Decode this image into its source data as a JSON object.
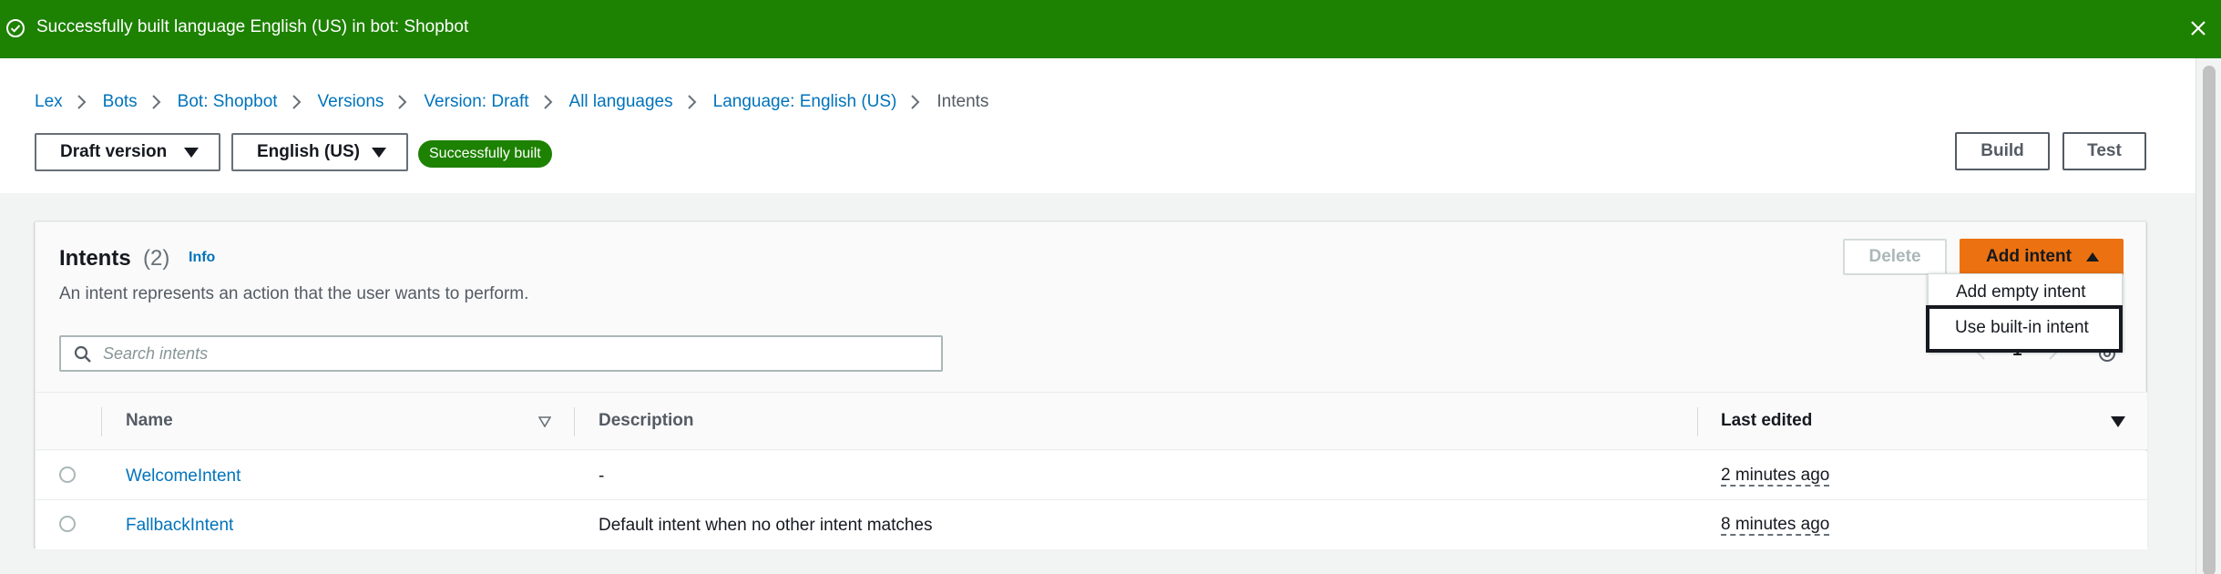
{
  "flash": {
    "message": "Successfully built language English (US) in bot: Shopbot",
    "icon": "check-circle-icon",
    "close_icon": "close-icon",
    "color": "#1d8102"
  },
  "breadcrumb": [
    "Lex",
    "Bots",
    "Bot: Shopbot",
    "Versions",
    "Version: Draft",
    "All languages",
    "Language: English (US)",
    "Intents"
  ],
  "toolbar": {
    "version_select": "Draft version",
    "language_select": "English (US)",
    "status_badge": "Successfully built",
    "build_label": "Build",
    "test_label": "Test"
  },
  "intents": {
    "title": "Intents",
    "count": "(2)",
    "info_label": "Info",
    "description": "An intent represents an action that the user wants to perform.",
    "delete_label": "Delete",
    "add_intent_label": "Add intent",
    "search_placeholder": "Search intents",
    "page_number": "1",
    "columns": {
      "name": "Name",
      "description": "Description",
      "last_edited": "Last edited"
    },
    "rows": [
      {
        "name": "WelcomeIntent",
        "description": "-",
        "last_edited": "2 minutes ago"
      },
      {
        "name": "FallbackIntent",
        "description": "Default intent when no other intent matches",
        "last_edited": "8 minutes ago"
      }
    ]
  },
  "add_intent_menu": {
    "items": [
      "Add empty intent",
      "Use built-in intent"
    ],
    "focused_item": "Use built-in intent"
  },
  "colors": {
    "link": "#0073bb",
    "primary_button": "#ec7211",
    "success": "#1d8102"
  }
}
